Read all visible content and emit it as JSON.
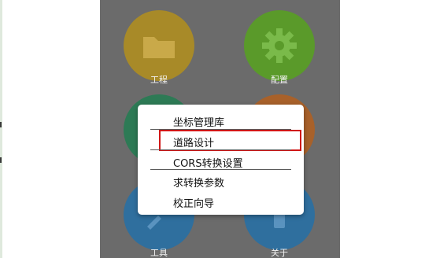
{
  "colors": {
    "overlay_background": "#6b6b6b",
    "tile_project": "#a88a28",
    "tile_config": "#5a9a2a",
    "tile_tools": "#2f6f9e",
    "tile_about": "#2f6f9e",
    "highlight": "#d01616"
  },
  "grid": {
    "tiles": [
      {
        "label": "工程",
        "icon": "folder-icon"
      },
      {
        "label": "配置",
        "icon": "gear-icon"
      },
      {
        "label": "工具",
        "icon": "tools-icon"
      },
      {
        "label": "关于",
        "icon": "info-icon"
      }
    ]
  },
  "menu": {
    "items": [
      {
        "label": "坐标管理库"
      },
      {
        "label": "道路设计"
      },
      {
        "label": "CORS转换设置"
      },
      {
        "label": "求转换参数"
      },
      {
        "label": "校正向导"
      }
    ],
    "highlighted_item": "道路设计"
  }
}
